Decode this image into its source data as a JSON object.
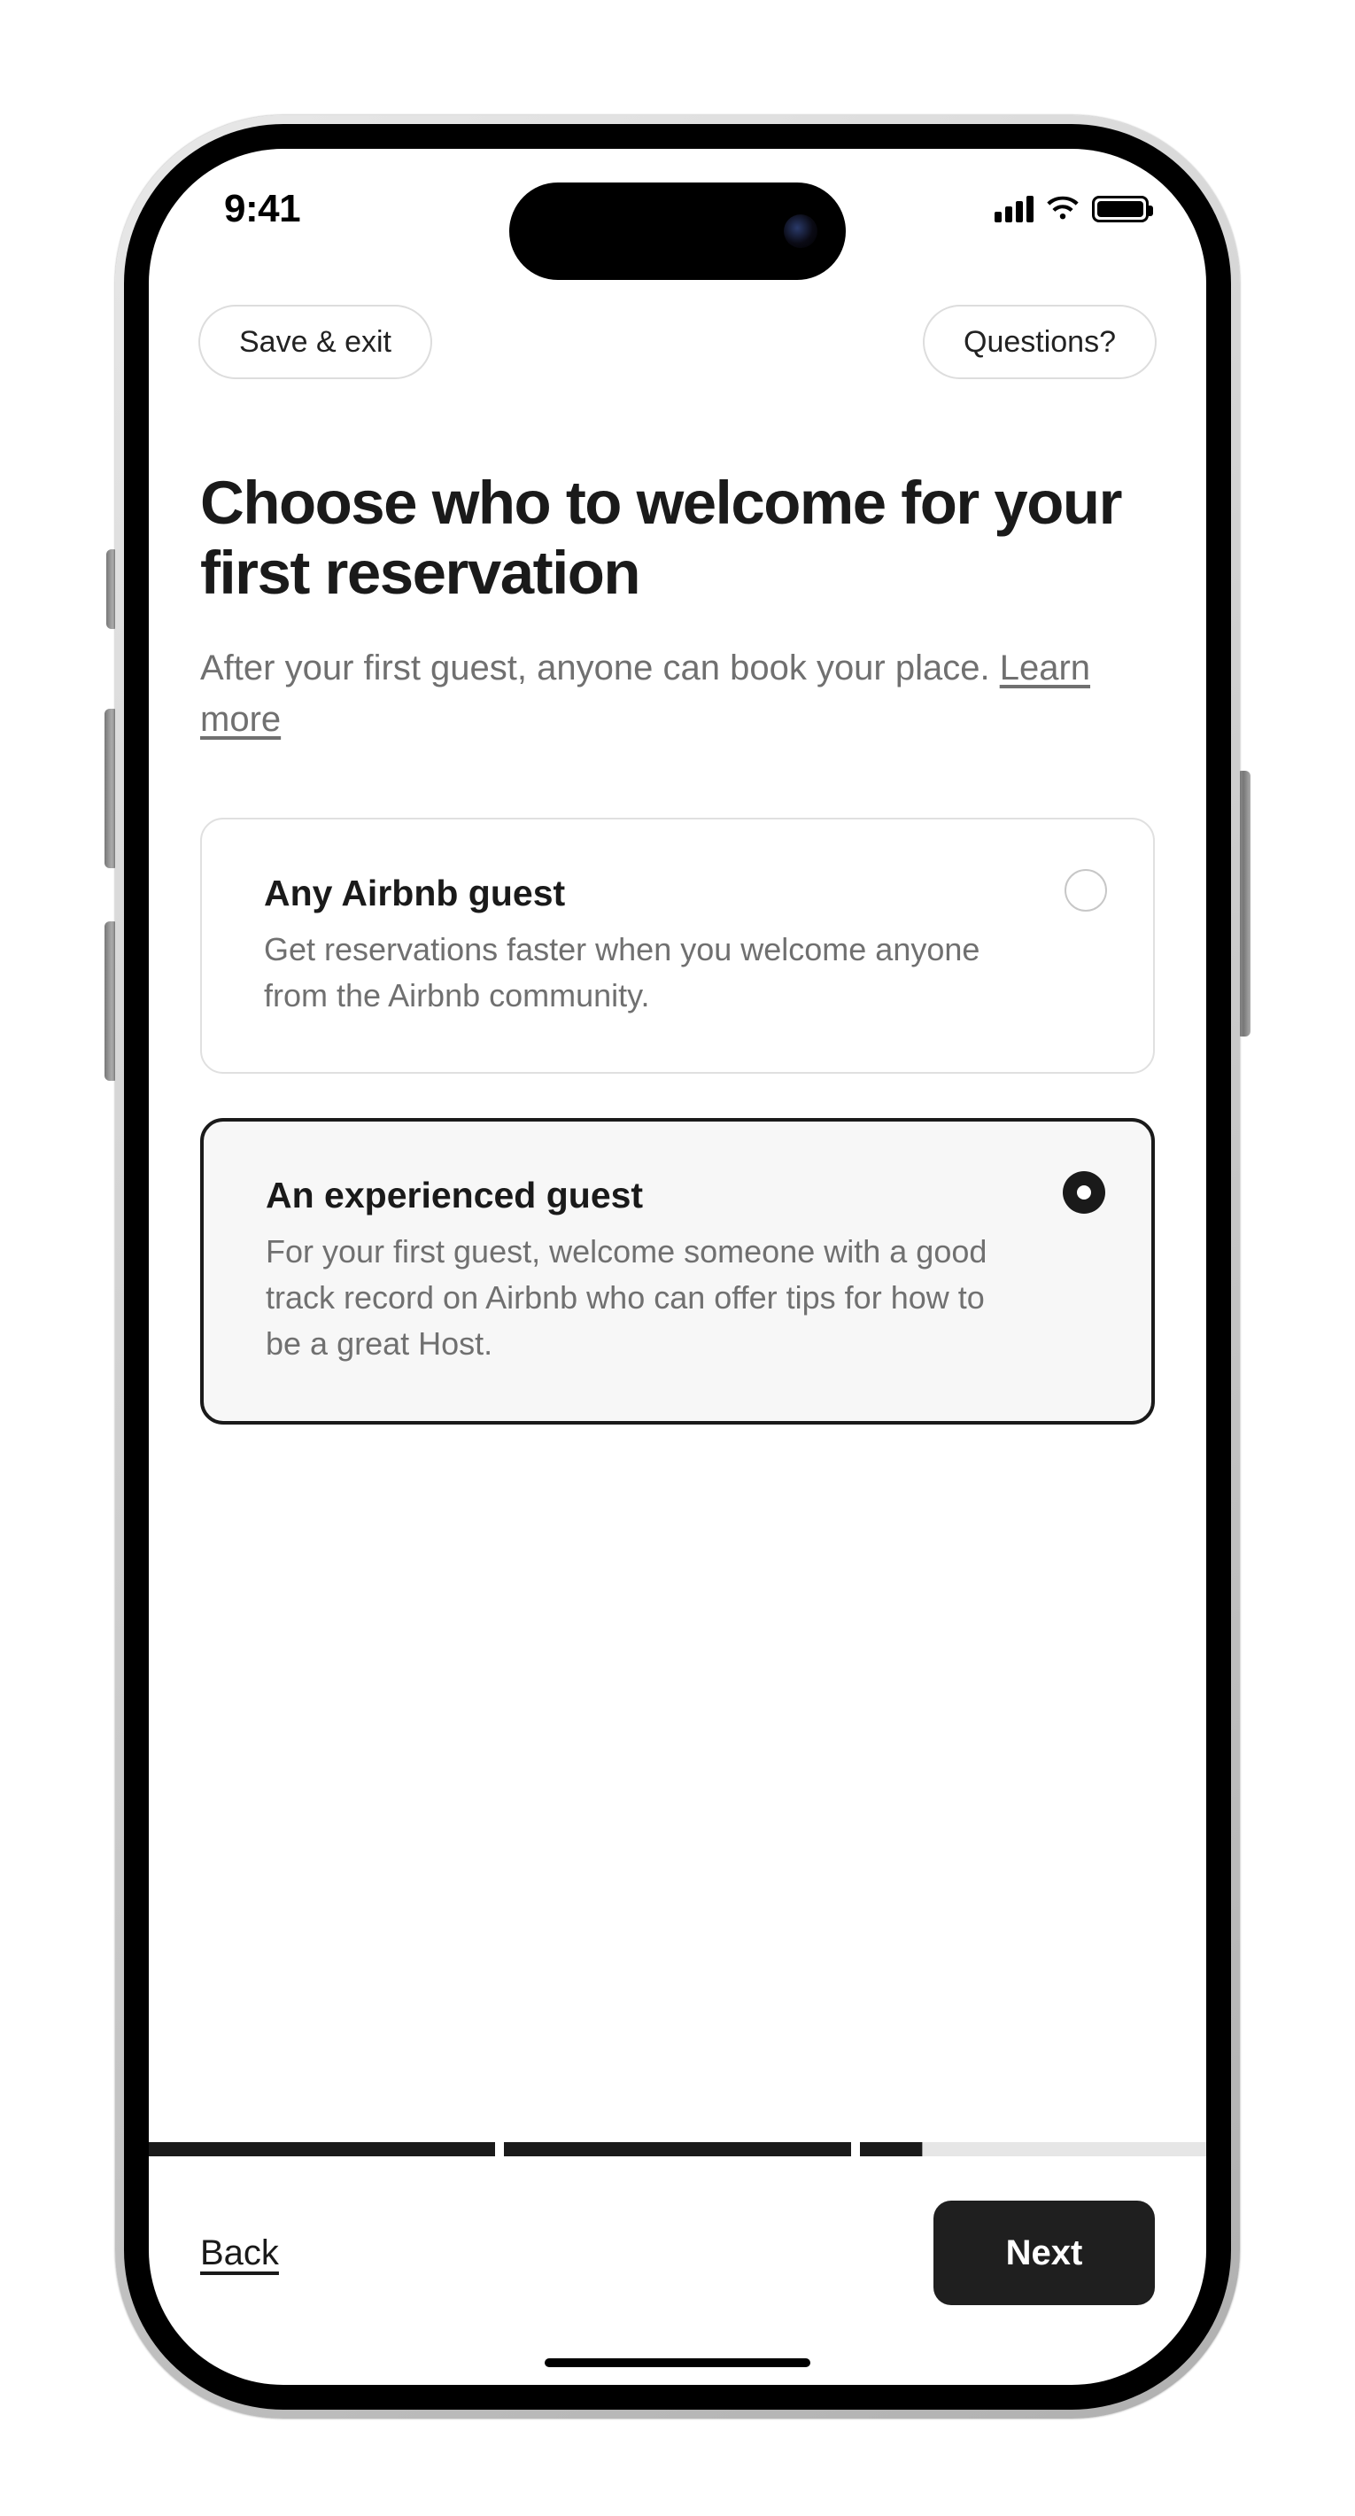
{
  "status": {
    "time": "9:41"
  },
  "topbar": {
    "save_exit": "Save & exit",
    "questions": "Questions?"
  },
  "heading": {
    "title": "Choose who to welcome for your first reservation",
    "subtitle_prefix": "After your first guest, anyone can book your place. ",
    "learn_more": "Learn more"
  },
  "options": [
    {
      "title": "Any Airbnb guest",
      "desc": "Get reservations faster when you welcome anyone from the Airbnb community.",
      "selected": false
    },
    {
      "title": "An experienced guest",
      "desc": "For your first guest, welcome someone with a good track record on Airbnb who can offer tips for how to be a great Host.",
      "selected": true
    }
  ],
  "progress": {
    "segments": [
      1,
      1,
      0.18
    ]
  },
  "footer": {
    "back": "Back",
    "next": "Next"
  }
}
